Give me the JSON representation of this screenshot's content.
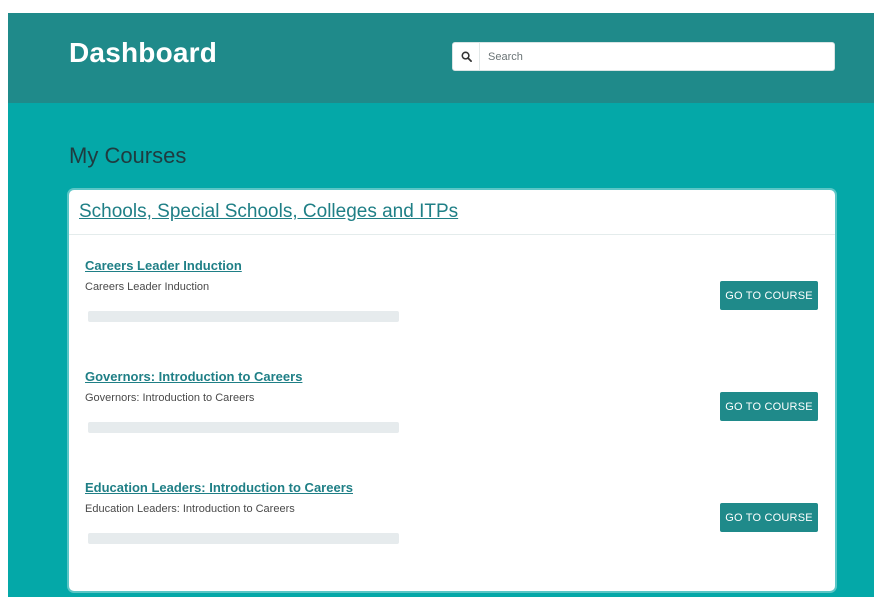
{
  "header": {
    "title": "Dashboard",
    "search": {
      "placeholder": "Search",
      "value": "",
      "icon": "search-icon"
    }
  },
  "main": {
    "section_title": "My Courses",
    "category": {
      "title": "Schools, Special Schools, Colleges and ITPs",
      "courses": [
        {
          "title": "Careers Leader Induction",
          "subtitle": "Careers Leader Induction",
          "progress": 0,
          "button_label": "GO TO COURSE"
        },
        {
          "title": "Governors: Introduction to Careers",
          "subtitle": "Governors: Introduction to Careers",
          "progress": 0,
          "button_label": "GO TO COURSE"
        },
        {
          "title": "Education Leaders: Introduction to Careers",
          "subtitle": "Education Leaders: Introduction to Careers",
          "progress": 0,
          "button_label": "GO TO COURSE"
        }
      ]
    }
  },
  "colors": {
    "header_bg": "#1f8a8a",
    "page_bg": "#04a8a8",
    "accent": "#1f7f86",
    "button_bg": "#1f8a8a",
    "progress_track": "#e6ebed"
  }
}
